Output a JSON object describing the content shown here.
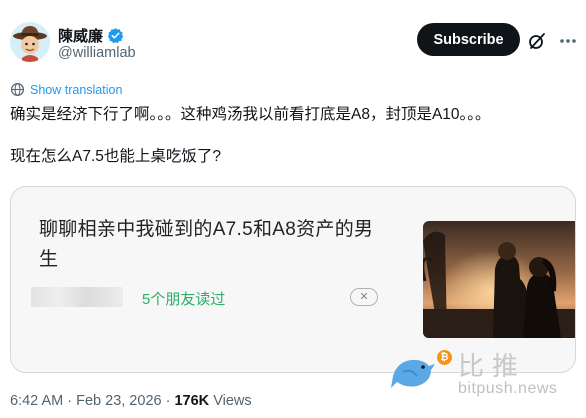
{
  "author": {
    "name": "陳威廉",
    "handle": "@williamlab",
    "verified": true,
    "avatar_icon": "cowboy-cartoon-avatar"
  },
  "header": {
    "subscribe_label": "Subscribe",
    "grok_icon": "grok-icon",
    "more_icon": "more-options-icon"
  },
  "translation": {
    "label": "Show translation",
    "icon": "globe-icon"
  },
  "tweet": {
    "text": "确实是经济下行了啊。。。这种鸡汤我以前看打底是A8，封顶是A10。。。\n\n现在怎么A7.5也能上桌吃饭了?"
  },
  "card": {
    "title": "聊聊相亲中我碰到的A7.5和A8资产的男生",
    "friends_read": "5个朋友读过",
    "close_icon": "close-icon",
    "image_desc_icon": "couple-sunset-image"
  },
  "watermark": {
    "cn": "比推",
    "url": "bitpush.news",
    "bitcoin_symbol": "₿"
  },
  "meta": {
    "time": "6:42 AM",
    "date": "Feb 23, 2026",
    "views_count": "176K",
    "views_label": "Views",
    "separator": "·"
  },
  "colors": {
    "accent": "#1d9bf0",
    "friends_green": "#2aae67",
    "verified_blue": "#1d9bf0",
    "bitcoin_orange": "#f7931a"
  }
}
